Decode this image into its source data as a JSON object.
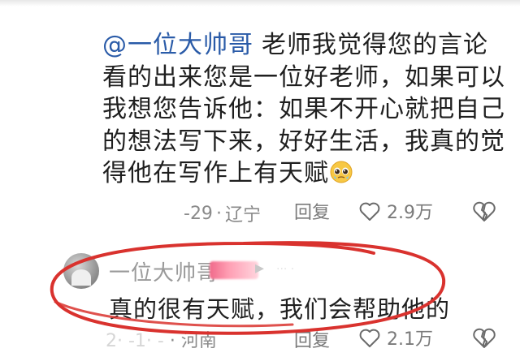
{
  "comment": {
    "mention": "@一位大帅哥",
    "text": "老师我觉得您的言论看的出来您是一位好老师，如果可以我想您告诉他：如果不开心就把自己的想法写下来，好好生活，我真的觉得他在写作上有天赋",
    "emoji": "pleading-face-emoji",
    "date": "-29",
    "location": "辽宁",
    "reply_label": "回复",
    "like_count": "2.9万"
  },
  "reply": {
    "username": "一位大帅哥",
    "text": "真的很有天赋，我们会帮助他的",
    "date": "2·  -1·  -",
    "location": "河南",
    "reply_label": "回复",
    "like_count": "2.1万"
  },
  "colors": {
    "mention": "#2a5ba8",
    "annotation_circle": "#d9322e",
    "meta_gray": "#8a8a8a"
  }
}
